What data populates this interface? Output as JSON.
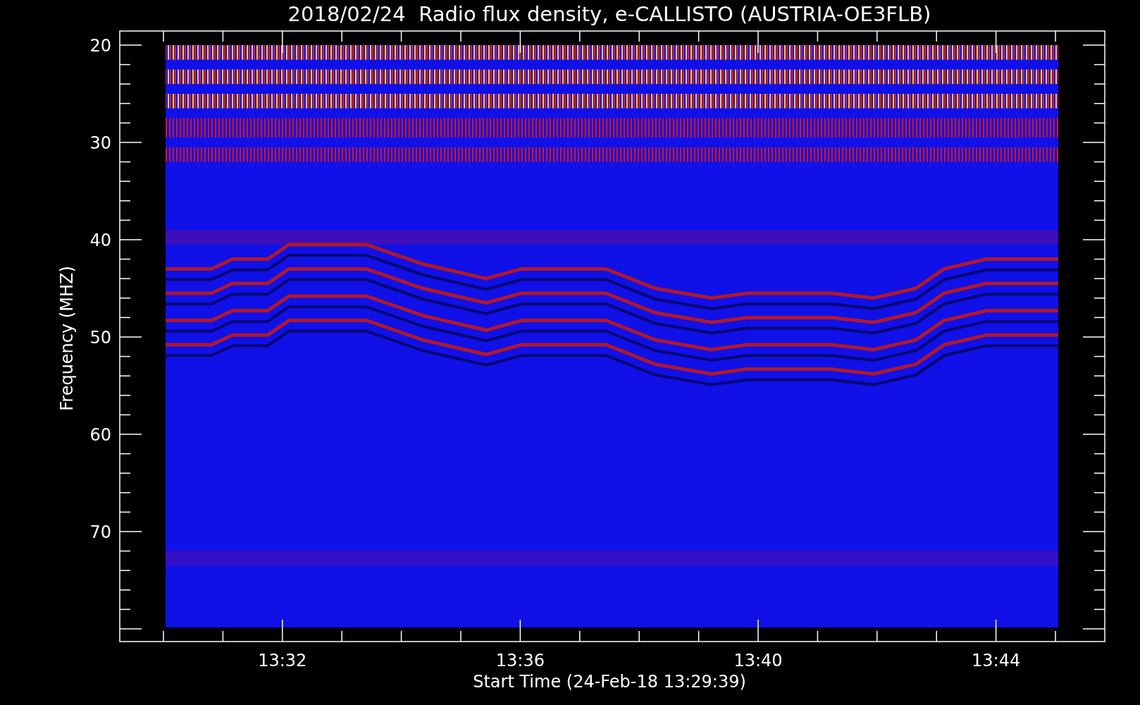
{
  "title": "2018/02/24  Radio flux density, e-CALLISTO (AUSTRIA-OE3FLB)",
  "plot": {
    "ylabel": "Frequency (MHZ)",
    "xlabel": "Start Time (24-Feb-18 13:29:39)",
    "y_tick_labels": [
      "20",
      "30",
      "40",
      "50",
      "60",
      "70"
    ],
    "x_tick_labels": [
      "13:32",
      "13:36",
      "13:40",
      "13:44"
    ]
  }
}
